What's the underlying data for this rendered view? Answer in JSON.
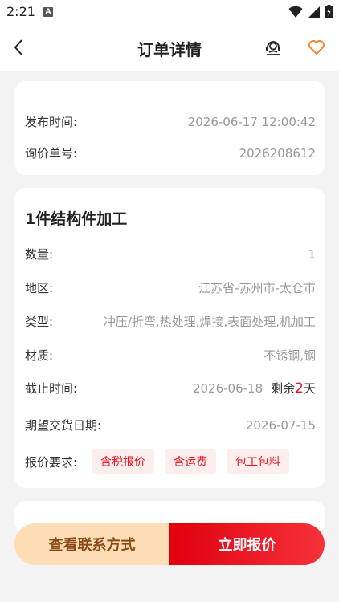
{
  "status": {
    "time": "2:21",
    "a_badge": "A"
  },
  "nav": {
    "title": "订单详情",
    "colors": {
      "heart": "#f08a3c"
    }
  },
  "info": {
    "publish_label": "发布时间:",
    "publish_value": "2026-06-17 12:00:42",
    "inquiry_label": "询价单号:",
    "inquiry_value": "2026208612"
  },
  "order": {
    "title": "1件结构件加工",
    "quantity_label": "数量:",
    "quantity_value": "1",
    "region_label": "地区:",
    "region_value": "江苏省-苏州市-太仓市",
    "type_label": "类型:",
    "type_value": "冲压/折弯,热处理,焊接,表面处理,机加工",
    "material_label": "材质:",
    "material_value": "不锈钢,钢",
    "deadline_label": "截止时间:",
    "deadline_value": "2026-06-18",
    "remain_prefix": "剩余",
    "remain_num": "2",
    "remain_suffix": "天",
    "delivery_label": "期望交货日期:",
    "delivery_value": "2026-07-15",
    "quote_label": "报价要求:",
    "quote_tags": [
      "含税报价",
      "含运费",
      "包工包料"
    ]
  },
  "actions": {
    "contact_label": "查看联系方式",
    "quote_label": "立即报价",
    "colors": {
      "primary": "#e8141f",
      "secondary_bg": "#fdddb5"
    }
  }
}
